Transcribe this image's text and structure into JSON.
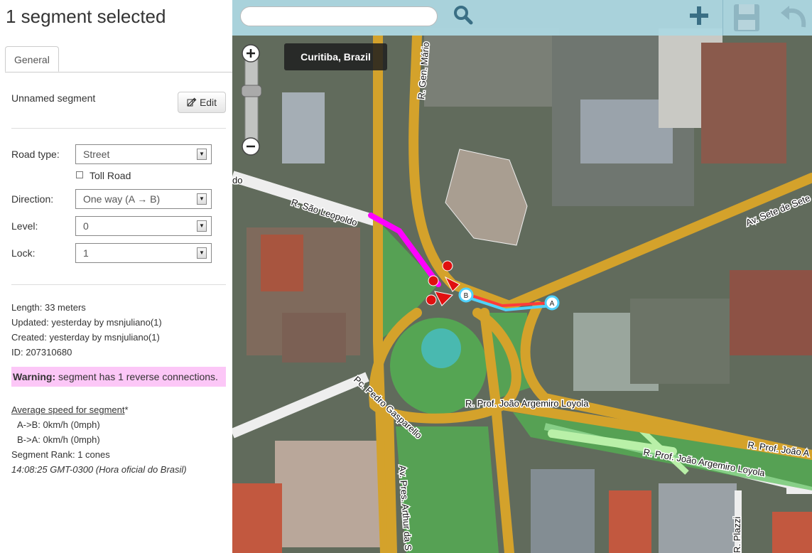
{
  "sidebar": {
    "title": "1 segment selected",
    "tabs": [
      {
        "label": "General"
      }
    ],
    "segment_name": "Unnamed segment",
    "edit_label": "Edit",
    "fields": {
      "road_type": {
        "label": "Road type:",
        "value": "Street"
      },
      "toll_road": {
        "label": "Toll Road",
        "checked": false
      },
      "direction": {
        "label": "Direction:",
        "value": "One way (A → B)"
      },
      "level": {
        "label": "Level:",
        "value": "0"
      },
      "lock": {
        "label": "Lock:",
        "value": "1"
      }
    },
    "info": {
      "length": "Length: 33 meters",
      "updated": "Updated: yesterday by msnjuliano(1)",
      "created": "Created: yesterday by msnjuliano(1)",
      "id": "ID: 207310680"
    },
    "warning": {
      "prefix": "Warning:",
      "text": " segment has 1 reverse connections."
    },
    "avg_speed": {
      "title": "Average speed for segment",
      "asterisk": "*",
      "a_to_b": "A->B: 0km/h (0mph)",
      "b_to_a": "B->A: 0km/h (0mph)"
    },
    "rank": "Segment Rank: 1 cones",
    "timestamp": "14:08:25 GMT-0300 (Hora oficial do Brasil)"
  },
  "map": {
    "city": "Curitiba, Brazil",
    "node_a": "A",
    "node_b": "B",
    "street_labels": {
      "sao_leopoldo": "R. São Leopoldo",
      "gen_mario": "R. Gen. Mário",
      "sete_setembro": "Av. Sete de Sete",
      "pedro_gasparello": "Pc. Pedro Gasparello",
      "prof_joao_1": "R. Prof. João Argemiro Loyola",
      "prof_joao_2": "R. Prof. João Argemiro Loyola",
      "prof_joao_3": "R. Prof. João A",
      "pres_arthur": "Av. Pres. Arthur da S",
      "plazzi": "R. Plazzi",
      "do": "do"
    }
  },
  "toolbar": {
    "search_placeholder": "",
    "icons": [
      "search-icon",
      "plus-icon",
      "save-icon",
      "undo-icon"
    ]
  },
  "colors": {
    "topbar": "#add8e2",
    "road": "#d4a22b",
    "selected": "#ff00ff",
    "warning_bg": "#fcc7f7",
    "green_area": "#4aa64a"
  }
}
